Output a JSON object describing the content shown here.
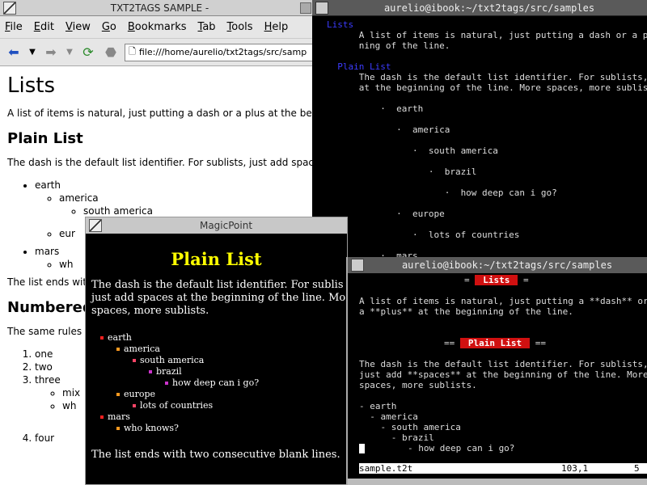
{
  "browser": {
    "title": "TXT2TAGS SAMPLE -",
    "menu": [
      "File",
      "Edit",
      "View",
      "Go",
      "Bookmarks",
      "Tab",
      "Tools",
      "Help"
    ],
    "url": "file:///home/aurelio/txt2tags/src/samp",
    "h1": "Lists",
    "intro": "A list of items is natural, just putting a dash or a plus at the beginnin",
    "h2_plain": "Plain List",
    "plain_para": "The dash is the default list identifier. For sublists, just add spaces a",
    "list_earth": "earth",
    "list_america": "america",
    "list_south": "south america",
    "list_eu": "eur",
    "list_mars": "mars",
    "list_wh": "wh",
    "ends_text": "The list ends with",
    "h2_numbered": "Numbered",
    "same_rules": "The same rules a",
    "num_one": "one",
    "num_two": "two",
    "num_three": "three",
    "num_mix": "mix",
    "num_wh": "wh",
    "num_four": "four"
  },
  "term1": {
    "title": "aurelio@ibook:~/txt2tags/src/samples",
    "lines": [
      {
        "t": "Lists",
        "c": "blue"
      },
      {
        "t": "      A list of items is natural, just putting a dash or a plus a",
        "c": ""
      },
      {
        "t": "      ning of the line.",
        "c": ""
      },
      {
        "t": "",
        "c": ""
      },
      {
        "t": "  Plain List",
        "c": "blue"
      },
      {
        "t": "      The dash is the default list identifier. For sublists, just",
        "c": ""
      },
      {
        "t": "      at the beginning of the line. More spaces, more sublists.",
        "c": ""
      },
      {
        "t": "",
        "c": ""
      },
      {
        "t": "          ·  earth",
        "c": ""
      },
      {
        "t": "",
        "c": ""
      },
      {
        "t": "             ·  america",
        "c": ""
      },
      {
        "t": "",
        "c": ""
      },
      {
        "t": "                ·  south america",
        "c": ""
      },
      {
        "t": "",
        "c": ""
      },
      {
        "t": "                   ·  brazil",
        "c": ""
      },
      {
        "t": "",
        "c": ""
      },
      {
        "t": "                      ·  how deep can i go?",
        "c": ""
      },
      {
        "t": "",
        "c": ""
      },
      {
        "t": "             ·  europe",
        "c": ""
      },
      {
        "t": "",
        "c": ""
      },
      {
        "t": "                ·  lots of countries",
        "c": ""
      },
      {
        "t": "",
        "c": ""
      },
      {
        "t": "          ·  mars",
        "c": ""
      }
    ],
    "prompt": ":"
  },
  "mgp": {
    "title": "MagicPoint",
    "heading": "Plain List",
    "para1": "The dash is the default list identifier. For sublis",
    "para2": "just add spaces at the beginning of the line. Mo",
    "para3": "spaces, more sublists.",
    "items": [
      {
        "text": "earth",
        "dot": "d1",
        "indent": 0
      },
      {
        "text": "america",
        "dot": "d2",
        "indent": 1
      },
      {
        "text": "south america",
        "dot": "d3",
        "indent": 2
      },
      {
        "text": "brazil",
        "dot": "d4",
        "indent": 3
      },
      {
        "text": "how deep can i go?",
        "dot": "d4",
        "indent": 4
      },
      {
        "text": "europe",
        "dot": "d2",
        "indent": 1
      },
      {
        "text": "lots of countries",
        "dot": "d3",
        "indent": 2
      },
      {
        "text": "mars",
        "dot": "d1",
        "indent": 0
      },
      {
        "text": "who knows?",
        "dot": "d2",
        "indent": 1
      }
    ],
    "footer": "The list ends with two consecutive blank lines."
  },
  "term2": {
    "title": "aurelio@ibook:~/txt2tags/src/samples",
    "lists_label": "Lists",
    "line1": "A list of items is natural, just putting a **dash** or",
    "line2": "a **plus** at the beginning of the line.",
    "plain_label": "Plain List",
    "line3": "The dash is the default list identifier. For sublists,",
    "line4": "just add **spaces** at the beginning of the line. More",
    "line5": "spaces, more sublists.",
    "tree": [
      "- earth",
      "  - america",
      "    - south america",
      "      - brazil",
      "        - how deep can i go?"
    ],
    "status_file": "sample.t2t",
    "status_pos": "103,1",
    "status_pct": "5"
  }
}
